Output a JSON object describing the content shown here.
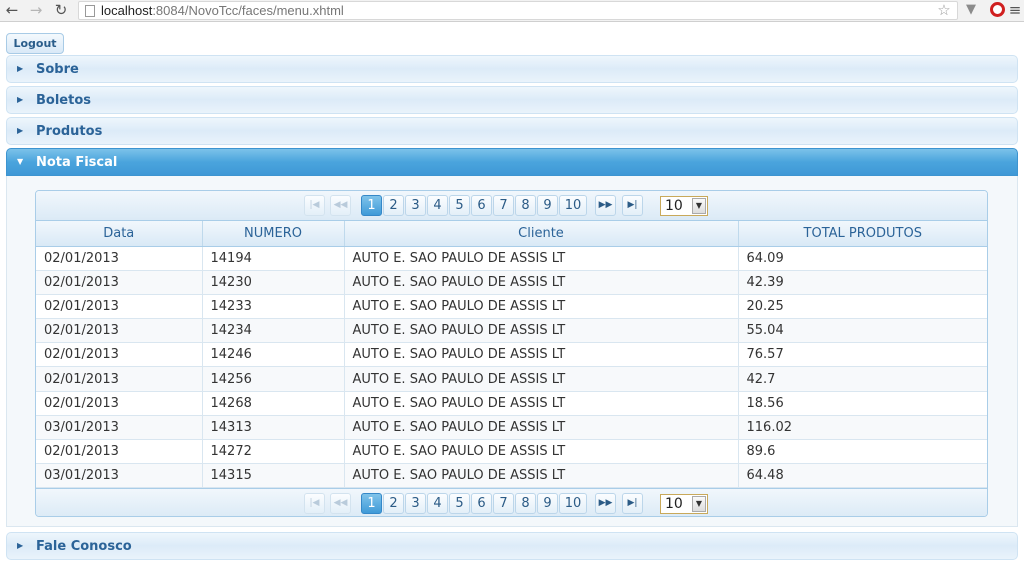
{
  "browser": {
    "url_host": "localhost",
    "url_rest": ":8084/NovoTcc/faces/menu.xhtml"
  },
  "logout_label": "Logout",
  "accordion": [
    {
      "label": "Sobre"
    },
    {
      "label": "Boletos"
    },
    {
      "label": "Produtos"
    },
    {
      "label": "Nota Fiscal",
      "expanded": true
    },
    {
      "label": "Fale Conosco"
    }
  ],
  "table": {
    "columns": [
      "Data",
      "NUMERO",
      "Cliente",
      "TOTAL PRODUTOS"
    ],
    "rows": [
      [
        "02/01/2013",
        "14194",
        "AUTO E. SAO PAULO DE ASSIS LT",
        "64.09"
      ],
      [
        "02/01/2013",
        "14230",
        "AUTO E. SAO PAULO DE ASSIS LT",
        "42.39"
      ],
      [
        "02/01/2013",
        "14233",
        "AUTO E. SAO PAULO DE ASSIS LT",
        "20.25"
      ],
      [
        "02/01/2013",
        "14234",
        "AUTO E. SAO PAULO DE ASSIS LT",
        "55.04"
      ],
      [
        "02/01/2013",
        "14246",
        "AUTO E. SAO PAULO DE ASSIS LT",
        "76.57"
      ],
      [
        "02/01/2013",
        "14256",
        "AUTO E. SAO PAULO DE ASSIS LT",
        "42.7"
      ],
      [
        "02/01/2013",
        "14268",
        "AUTO E. SAO PAULO DE ASSIS LT",
        "18.56"
      ],
      [
        "03/01/2013",
        "14313",
        "AUTO E. SAO PAULO DE ASSIS LT",
        "116.02"
      ],
      [
        "02/01/2013",
        "14272",
        "AUTO E. SAO PAULO DE ASSIS LT",
        "89.6"
      ],
      [
        "03/01/2013",
        "14315",
        "AUTO E. SAO PAULO DE ASSIS LT",
        "64.48"
      ]
    ]
  },
  "paginator": {
    "pages": [
      "1",
      "2",
      "3",
      "4",
      "5",
      "6",
      "7",
      "8",
      "9",
      "10"
    ],
    "current_page": "1",
    "rows_per_page": "10",
    "first_icon": "first-page-icon",
    "prev_icon": "previous-page-icon",
    "next_icon": "next-page-icon",
    "last_icon": "last-page-icon"
  },
  "colors": {
    "accent": "#4aa4dd",
    "header_text": "#2b6398"
  }
}
